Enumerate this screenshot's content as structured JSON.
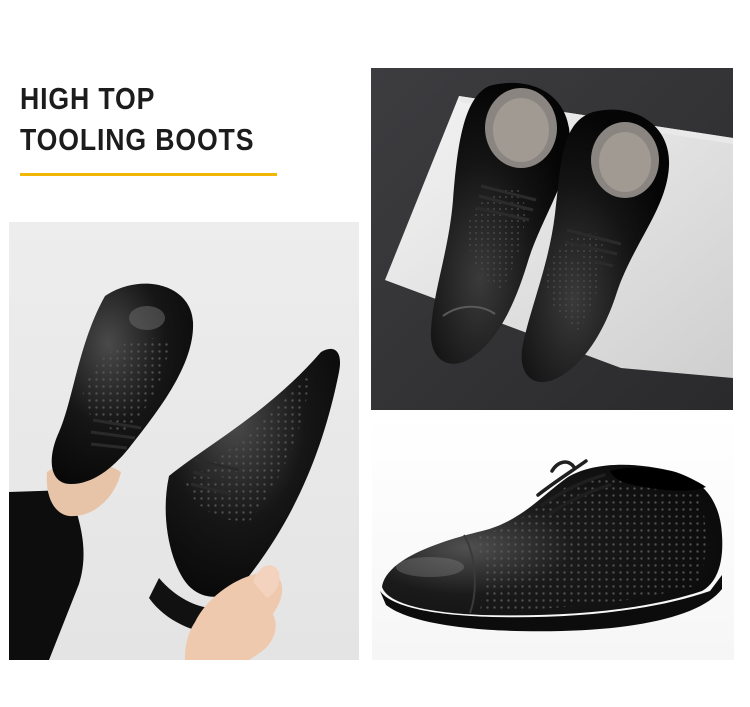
{
  "headline": {
    "line1": "HIGH TOP",
    "line2": "TOOLING BOOTS"
  },
  "colors": {
    "accent": "#f2b705",
    "text": "#1c1c1c",
    "background": "#ffffff"
  }
}
